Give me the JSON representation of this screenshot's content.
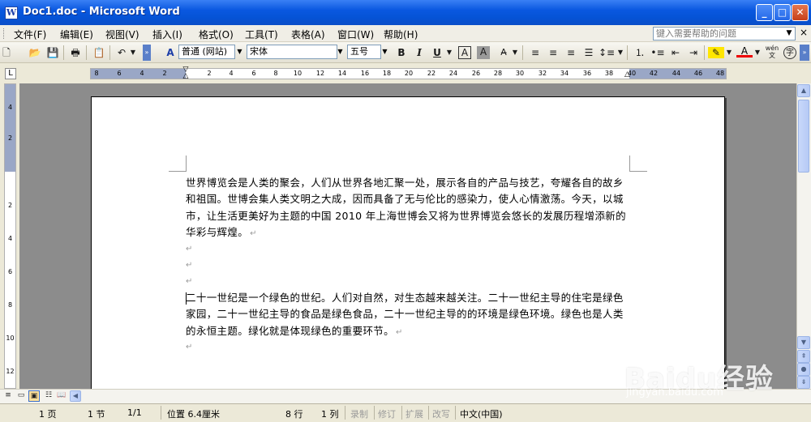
{
  "window": {
    "title": "Doc1.doc - Microsoft Word",
    "app_icon": "W",
    "minimize_glyph": "_",
    "maximize_glyph": "□",
    "close_glyph": "✕"
  },
  "menu": {
    "items": [
      "文件(F)",
      "编辑(E)",
      "视图(V)",
      "插入(I)",
      "格式(O)",
      "工具(T)",
      "表格(A)",
      "窗口(W)",
      "帮助(H)"
    ],
    "help_placeholder": "键入需要帮助的问题",
    "close_glyph": "×"
  },
  "toolbar": {
    "style_value": "普通 (网站)",
    "font_value": "宋体",
    "size_value": "五号",
    "bold": "B",
    "italic": "I",
    "underline": "U",
    "char_border": "A",
    "char_shading": "A",
    "font_color": "A",
    "wen": "wén 文",
    "enclose": "字",
    "style_pane_glyph": "A"
  },
  "ruler": {
    "corner": "L",
    "ticks": [
      "8",
      "6",
      "4",
      "2",
      "2",
      "4",
      "6",
      "8",
      "10",
      "12",
      "14",
      "16",
      "18",
      "20",
      "22",
      "24",
      "26",
      "28",
      "30",
      "32",
      "34",
      "36",
      "38",
      "40",
      "42",
      "44",
      "46",
      "48"
    ],
    "vticks": [
      "4",
      "2",
      "2",
      "4",
      "6",
      "8",
      "10",
      "12"
    ]
  },
  "document": {
    "paragraph_1": "世界博览会是人类的聚会，人们从世界各地汇聚一处，展示各自的产品与技艺，夸耀各自的故乡和祖国。世博会集人类文明之大成，因而具备了无与伦比的感染力，使人心情激荡。今天，以城市，让生活更美好为主题的中国 2010 年上海世博会又将为世界博览会悠长的发展历程增添新的华彩与辉煌。",
    "paragraph_2": "二十一世纪是一个绿色的世纪。人们对自然，对生态越来越关注。二十一世纪主导的住宅是绿色家园，二十一世纪主导的食品是绿色食品，二十一世纪主导的的环境是绿色环境。绿色也是人类的永恒主题。绿化就是体现绿色的重要环节。",
    "para_mark": "↵"
  },
  "status": {
    "page": "1 页",
    "section": "1 节",
    "page_of": "1/1",
    "position": "位置 6.4厘米",
    "line": "8 行",
    "column": "1 列",
    "rec": "录制",
    "trk": "修订",
    "ext": "扩展",
    "ovr": "改写",
    "language": "中文(中国)"
  },
  "watermark": {
    "text": "Baidu经验",
    "url": "jingyan.baidu.com"
  },
  "colors": {
    "titlebar": "#0a58e0",
    "workspace": "#8c8c8c",
    "ruler_margin": "#9aa7c6"
  }
}
